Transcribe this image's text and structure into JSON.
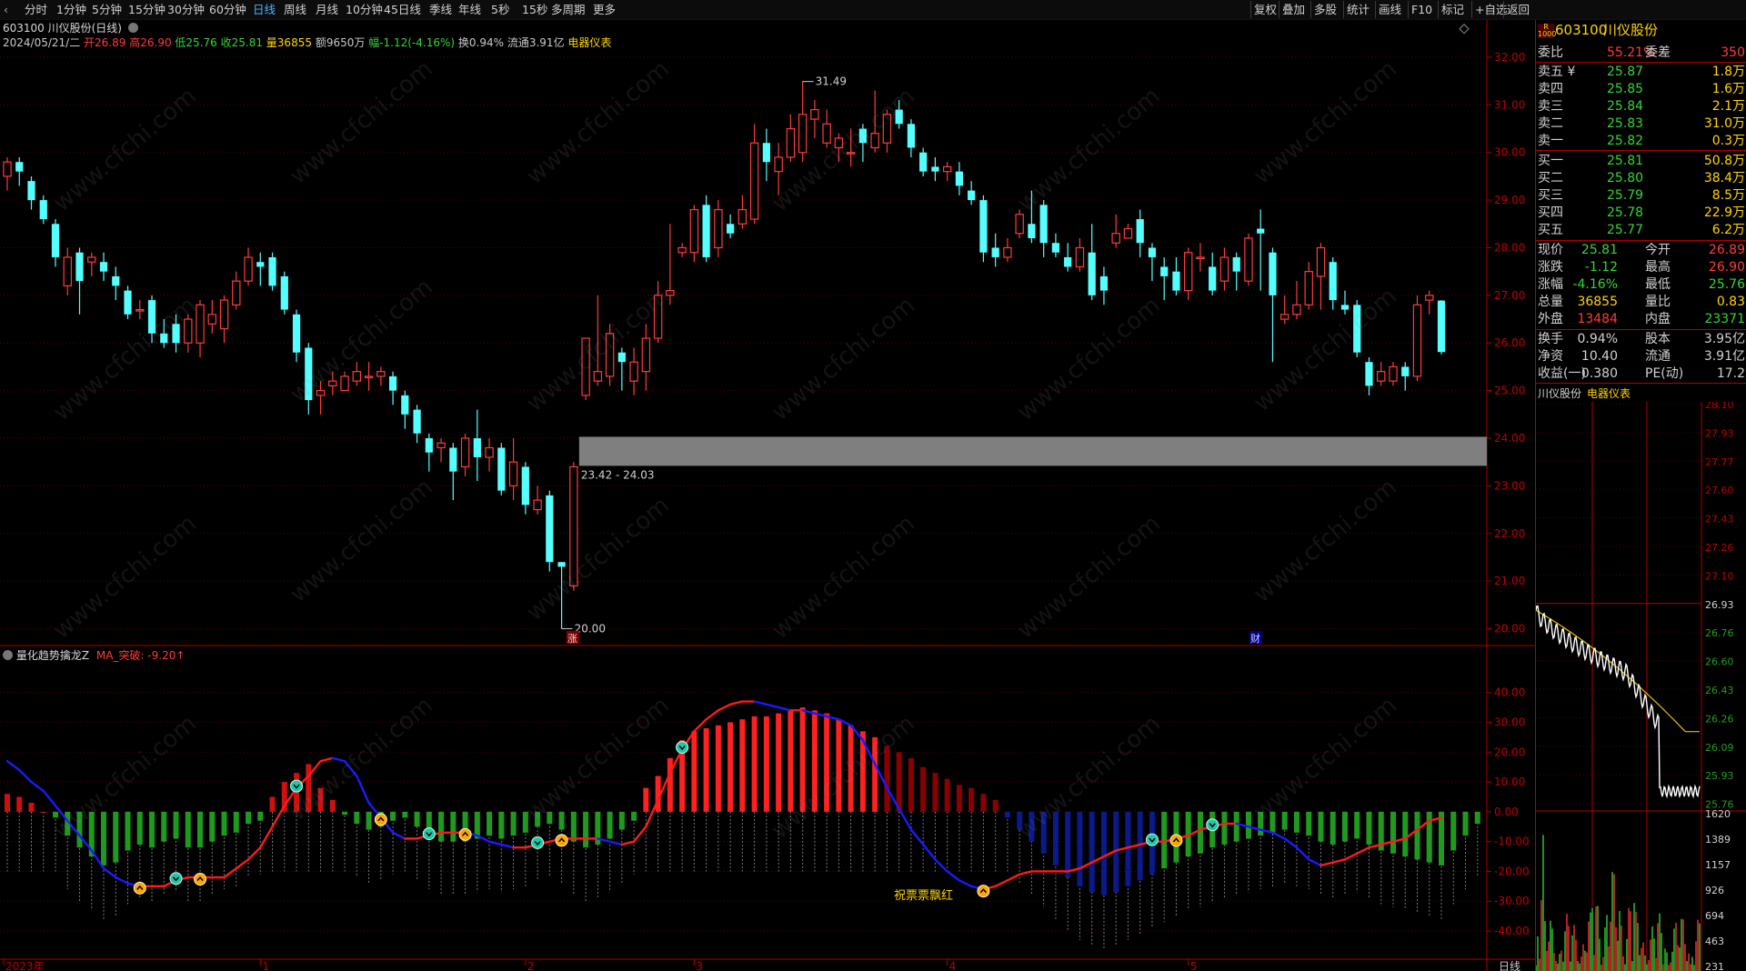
{
  "toolbar": {
    "periods": [
      "分时",
      "1分钟",
      "5分钟",
      "15分钟",
      "30分钟",
      "60分钟",
      "日线",
      "周线",
      "月线",
      "10分钟",
      "45日线",
      "季线",
      "年线",
      "5秒",
      "15秒",
      "多周期",
      "更多"
    ],
    "active_period": "日线",
    "tools": [
      "复权",
      "叠加",
      "多股",
      "统计",
      "画线",
      "F10",
      "标记",
      "+自选",
      "返回"
    ]
  },
  "main_chart": {
    "title": "603100 川仪股份(日线)",
    "info": {
      "date": "2024/05/21/二",
      "open": "开26.89",
      "high": "高26.90",
      "low": "低25.76",
      "close": "收25.81",
      "volume": "量36855",
      "amount": "额9650万",
      "change": "幅-1.12(-4.16%)",
      "turnover": "换0.94%",
      "float_cap": "流通3.91亿",
      "sector": "电器仪表"
    },
    "annotations": {
      "high_marker": "31.49",
      "low_marker": "20.00",
      "gap_range": "23.42 - 24.03",
      "event_up": "涨",
      "event_fin": "财"
    },
    "indicator_title": "量化趋势擒龙Z",
    "indicator_ma": "MA_突破: -9.20↑",
    "indicator_note": "祝票票飘红",
    "date_axis": [
      "2023年",
      "1",
      "2",
      "3",
      "4",
      "5"
    ],
    "period_label": "日线"
  },
  "chart_data": {
    "type": "candlestick",
    "price_ticks": [
      "32.00",
      "31.00",
      "30.00",
      "29.00",
      "28.00",
      "27.00",
      "26.00",
      "25.00",
      "24.00",
      "23.00",
      "22.00",
      "21.00",
      "20.00"
    ],
    "indicator_ticks": [
      "40.00",
      "30.00",
      "20.00",
      "10.00",
      "0.00",
      "-10.00",
      "-20.00",
      "-30.00",
      "-40.00"
    ],
    "ylim_price": [
      19.8,
      32.4
    ],
    "ylim_indicator": [
      -47,
      46
    ],
    "high_value": 31.49,
    "low_value": 20.0,
    "gap": [
      23.42,
      24.03
    ],
    "candles": [
      [
        29.5,
        29.8,
        29.2,
        29.9
      ],
      [
        29.8,
        29.6,
        29.3,
        29.9
      ],
      [
        29.4,
        29.0,
        28.8,
        29.5
      ],
      [
        29.0,
        28.6,
        28.5,
        29.1
      ],
      [
        28.5,
        27.8,
        27.6,
        28.6
      ],
      [
        27.2,
        27.8,
        27.0,
        28.0
      ],
      [
        27.9,
        27.3,
        26.6,
        28.0
      ],
      [
        27.7,
        27.8,
        27.4,
        27.9
      ],
      [
        27.7,
        27.5,
        27.3,
        27.9
      ],
      [
        27.4,
        27.2,
        26.9,
        27.6
      ],
      [
        27.1,
        26.6,
        26.5,
        27.2
      ],
      [
        26.7,
        26.7,
        26.5,
        26.9
      ],
      [
        26.9,
        26.2,
        26.0,
        27.0
      ],
      [
        26.2,
        26.0,
        25.9,
        26.5
      ],
      [
        26.4,
        26.0,
        25.8,
        26.6
      ],
      [
        26.0,
        26.5,
        25.8,
        26.6
      ],
      [
        26.0,
        26.8,
        25.7,
        26.9
      ],
      [
        26.4,
        26.6,
        26.2,
        26.9
      ],
      [
        26.3,
        26.9,
        26.0,
        27.0
      ],
      [
        26.8,
        27.3,
        26.7,
        27.5
      ],
      [
        27.3,
        27.8,
        27.2,
        28.0
      ],
      [
        27.7,
        27.6,
        27.2,
        27.9
      ],
      [
        27.8,
        27.2,
        27.1,
        27.9
      ],
      [
        27.4,
        26.7,
        26.6,
        27.5
      ],
      [
        26.6,
        25.8,
        25.6,
        26.7
      ],
      [
        25.9,
        24.8,
        24.5,
        26.0
      ],
      [
        24.9,
        25.0,
        24.5,
        25.2
      ],
      [
        25.1,
        25.2,
        24.9,
        25.4
      ],
      [
        25.0,
        25.3,
        25.0,
        25.4
      ],
      [
        25.2,
        25.4,
        25.1,
        25.6
      ],
      [
        25.3,
        25.3,
        25.0,
        25.6
      ],
      [
        25.3,
        25.4,
        25.1,
        25.5
      ],
      [
        25.3,
        25.0,
        24.7,
        25.4
      ],
      [
        24.9,
        24.5,
        24.2,
        25.0
      ],
      [
        24.6,
        24.1,
        23.9,
        24.7
      ],
      [
        24.0,
        23.7,
        23.3,
        24.1
      ],
      [
        23.8,
        23.9,
        23.5,
        24.0
      ],
      [
        23.8,
        23.3,
        22.7,
        23.9
      ],
      [
        23.4,
        24.0,
        23.2,
        24.1
      ],
      [
        24.0,
        23.6,
        23.1,
        24.6
      ],
      [
        23.6,
        23.8,
        23.3,
        24.0
      ],
      [
        23.8,
        22.9,
        22.8,
        23.9
      ],
      [
        23.0,
        23.5,
        22.7,
        24.0
      ],
      [
        23.4,
        22.6,
        22.4,
        23.5
      ],
      [
        22.5,
        22.7,
        22.4,
        23.0
      ],
      [
        22.8,
        21.4,
        21.2,
        22.9
      ],
      [
        21.4,
        21.3,
        20.0,
        21.4
      ],
      [
        20.9,
        23.4,
        20.8,
        23.5
      ],
      [
        24.9,
        26.1,
        24.8,
        26.1
      ],
      [
        25.2,
        25.4,
        25.1,
        27.0
      ],
      [
        25.3,
        26.2,
        25.1,
        26.4
      ],
      [
        25.8,
        25.6,
        25.0,
        25.9
      ],
      [
        25.2,
        25.6,
        24.9,
        25.9
      ],
      [
        25.4,
        26.1,
        25.0,
        26.4
      ],
      [
        26.1,
        27.0,
        26.0,
        27.3
      ],
      [
        27.0,
        27.1,
        26.8,
        28.5
      ],
      [
        27.9,
        28.0,
        27.8,
        28.1
      ],
      [
        27.9,
        28.8,
        27.7,
        28.9
      ],
      [
        28.9,
        27.8,
        27.7,
        29.1
      ],
      [
        28.0,
        28.8,
        27.8,
        29.0
      ],
      [
        28.5,
        28.3,
        28.2,
        28.7
      ],
      [
        28.5,
        28.8,
        28.4,
        29.1
      ],
      [
        28.6,
        30.2,
        28.5,
        30.6
      ],
      [
        30.2,
        29.8,
        29.4,
        30.5
      ],
      [
        29.6,
        29.9,
        29.1,
        30.2
      ],
      [
        29.9,
        30.5,
        29.8,
        30.8
      ],
      [
        30.0,
        30.8,
        29.8,
        31.5
      ],
      [
        30.7,
        30.9,
        30.3,
        31.1
      ],
      [
        30.2,
        30.6,
        30.1,
        30.9
      ],
      [
        30.1,
        30.3,
        29.8,
        30.4
      ],
      [
        30.0,
        30.0,
        29.7,
        30.5
      ],
      [
        30.5,
        30.2,
        29.8,
        30.6
      ],
      [
        30.1,
        30.4,
        30.0,
        31.3
      ],
      [
        30.2,
        30.8,
        30.0,
        30.9
      ],
      [
        30.9,
        30.6,
        30.5,
        31.1
      ],
      [
        30.6,
        30.1,
        29.9,
        30.7
      ],
      [
        30.0,
        29.6,
        29.5,
        30.1
      ],
      [
        29.7,
        29.6,
        29.4,
        29.9
      ],
      [
        29.6,
        29.7,
        29.4,
        29.8
      ],
      [
        29.6,
        29.3,
        29.1,
        29.8
      ],
      [
        29.2,
        29.0,
        28.9,
        29.4
      ],
      [
        29.0,
        27.9,
        27.7,
        29.1
      ],
      [
        28.0,
        27.8,
        27.6,
        28.3
      ],
      [
        27.8,
        28.0,
        27.7,
        28.2
      ],
      [
        28.3,
        28.7,
        28.2,
        28.8
      ],
      [
        28.5,
        28.2,
        28.1,
        29.2
      ],
      [
        28.9,
        28.1,
        27.8,
        29.0
      ],
      [
        28.1,
        27.9,
        27.8,
        28.3
      ],
      [
        27.8,
        27.6,
        27.5,
        28.1
      ],
      [
        27.6,
        28.0,
        27.5,
        28.2
      ],
      [
        27.9,
        27.0,
        26.9,
        28.5
      ],
      [
        27.4,
        27.1,
        26.8,
        27.6
      ],
      [
        28.1,
        28.3,
        28.0,
        28.7
      ],
      [
        28.2,
        28.4,
        28.2,
        28.5
      ],
      [
        28.6,
        28.1,
        27.8,
        28.8
      ],
      [
        28.0,
        27.8,
        27.3,
        28.1
      ],
      [
        27.6,
        27.4,
        26.9,
        27.8
      ],
      [
        27.5,
        27.1,
        27.0,
        27.8
      ],
      [
        27.1,
        27.9,
        26.9,
        28.0
      ],
      [
        27.8,
        27.8,
        27.5,
        28.1
      ],
      [
        27.6,
        27.1,
        27.0,
        27.9
      ],
      [
        27.3,
        27.8,
        27.1,
        28.0
      ],
      [
        27.8,
        27.5,
        27.1,
        27.9
      ],
      [
        27.3,
        28.2,
        27.2,
        28.3
      ],
      [
        28.4,
        28.3,
        27.1,
        28.8
      ],
      [
        27.9,
        27.0,
        25.6,
        28.0
      ],
      [
        26.5,
        26.6,
        26.4,
        27.0
      ],
      [
        26.6,
        26.8,
        26.5,
        27.3
      ],
      [
        26.8,
        27.5,
        26.7,
        27.7
      ],
      [
        27.4,
        28.0,
        26.7,
        28.1
      ],
      [
        27.7,
        26.9,
        26.7,
        27.8
      ],
      [
        26.8,
        26.7,
        26.6,
        27.1
      ],
      [
        26.8,
        25.8,
        25.7,
        26.9
      ],
      [
        25.6,
        25.1,
        24.9,
        25.7
      ],
      [
        25.2,
        25.4,
        25.1,
        25.6
      ],
      [
        25.2,
        25.5,
        25.1,
        25.6
      ],
      [
        25.5,
        25.3,
        25.0,
        25.6
      ],
      [
        25.3,
        26.8,
        25.2,
        27.0
      ],
      [
        26.9,
        27.0,
        26.6,
        27.1
      ],
      [
        26.89,
        25.81,
        25.76,
        26.9
      ]
    ],
    "macd_hist": [
      6,
      5,
      3,
      0,
      -2,
      -8,
      -12,
      -15,
      -18,
      -17,
      -13,
      -11,
      -12,
      -10,
      -9,
      -12,
      -12,
      -10,
      -8,
      -7,
      -4,
      -3,
      5,
      10,
      13,
      16,
      8,
      4,
      -1,
      -4,
      -6,
      -5,
      -3,
      -2,
      -5,
      -8,
      -10,
      -10,
      -10,
      -9,
      -8,
      -9,
      -8,
      -7,
      -5,
      -4,
      -6,
      -10,
      -12,
      -11,
      -9,
      -6,
      -3,
      8,
      12,
      18,
      24,
      27,
      28,
      29,
      30,
      31,
      32,
      32,
      33,
      34,
      35,
      34,
      33,
      31,
      29,
      27,
      25,
      22,
      20,
      18,
      15,
      13,
      11,
      9,
      8,
      6,
      4,
      -2,
      -6,
      -10,
      -14,
      -18,
      -22,
      -25,
      -27,
      -28,
      -27,
      -25,
      -23,
      -21,
      -19,
      -17,
      -15,
      -14,
      -12,
      -11,
      -10,
      -9,
      -8,
      -7,
      -6,
      -7,
      -8,
      -10,
      -11,
      -10,
      -9,
      -11,
      -13,
      -14,
      -15,
      -16,
      -17,
      -18,
      -13,
      -8,
      -4
    ],
    "trend_line": [
      17,
      14,
      10,
      7,
      2,
      -3,
      -8,
      -13,
      -19,
      -22,
      -24,
      -25,
      -25,
      -25,
      -23,
      -22,
      -22,
      -22,
      -22,
      -19,
      -16,
      -12,
      -5,
      2,
      8,
      12,
      17,
      18,
      17,
      12,
      3,
      -2,
      -7,
      -9,
      -9,
      -8,
      -7,
      -7,
      -7,
      -8,
      -10,
      -11,
      -12,
      -12,
      -11,
      -10,
      -9,
      -9,
      -9,
      -9,
      -10,
      -11,
      -10,
      -5,
      4,
      13,
      21,
      27,
      31,
      34,
      36,
      37,
      37,
      36,
      35,
      34,
      34,
      33,
      32,
      31,
      29,
      24,
      16,
      8,
      1,
      -6,
      -11,
      -16,
      -20,
      -23,
      -25,
      -26,
      -25,
      -23,
      -21,
      -20,
      -20,
      -20,
      -20,
      -19,
      -17,
      -15,
      -13,
      -12,
      -11,
      -10,
      -10,
      -9,
      -8,
      -6,
      -5,
      -4,
      -4,
      -5,
      -6,
      -7,
      -9,
      -12,
      -16,
      -18,
      -17,
      -16,
      -14,
      -12,
      -11,
      -10,
      -9,
      -6,
      -3,
      -2
    ],
    "buy_signals": [
      11,
      16,
      31,
      38,
      46,
      81,
      97
    ],
    "sell_signals": [
      14,
      24,
      35,
      44,
      56,
      95,
      100
    ],
    "tick_indices": [
      0,
      21,
      43,
      57,
      78,
      98
    ]
  },
  "quote": {
    "code": "603100",
    "name": "川仪股份",
    "weibi_label": "委比",
    "weibi": "55.21%",
    "weicha_label": "委差",
    "weicha": "350",
    "asks": [
      {
        "label": "卖五 ¥",
        "price": "25.87",
        "vol": "1.8万"
      },
      {
        "label": "卖四",
        "price": "25.85",
        "vol": "1.6万"
      },
      {
        "label": "卖三",
        "price": "25.84",
        "vol": "2.1万"
      },
      {
        "label": "卖二",
        "price": "25.83",
        "vol": "31.0万"
      },
      {
        "label": "卖一",
        "price": "25.82",
        "vol": "0.3万"
      }
    ],
    "bids": [
      {
        "label": "买一",
        "price": "25.81",
        "vol": "50.8万"
      },
      {
        "label": "买二",
        "price": "25.80",
        "vol": "38.4万"
      },
      {
        "label": "买三",
        "price": "25.79",
        "vol": "8.5万"
      },
      {
        "label": "买四",
        "price": "25.78",
        "vol": "22.9万"
      },
      {
        "label": "买五",
        "price": "25.77",
        "vol": "6.2万"
      }
    ],
    "stats": [
      {
        "l1": "现价",
        "v1": "25.81",
        "c1": "#36d436",
        "l2": "今开",
        "v2": "26.89",
        "c2": "#ff3b3b"
      },
      {
        "l1": "涨跌",
        "v1": "-1.12",
        "c1": "#36d436",
        "l2": "最高",
        "v2": "26.90",
        "c2": "#ff3b3b"
      },
      {
        "l1": "涨幅",
        "v1": "-4.16%",
        "c1": "#36d436",
        "l2": "最低",
        "v2": "25.76",
        "c2": "#36d436"
      },
      {
        "l1": "总量",
        "v1": "36855",
        "c1": "#ffd500",
        "l2": "量比",
        "v2": "0.83",
        "c2": "#ffd500"
      },
      {
        "l1": "外盘",
        "v1": "13484",
        "c1": "#ff3b3b",
        "l2": "内盘",
        "v2": "23371",
        "c2": "#36d436"
      }
    ],
    "stats2": [
      {
        "l1": "换手",
        "v1": "0.94%",
        "l2": "股本",
        "v2": "3.95亿"
      },
      {
        "l1": "净资",
        "v1": "10.40",
        "l2": "流通",
        "v2": "3.91亿"
      },
      {
        "l1": "收益(一)",
        "v1": "0.380",
        "l2": "PE(动)",
        "v2": "17.2"
      }
    ],
    "mini_title": "川仪股份",
    "mini_sector": "电器仪表",
    "mini_price_ticks": [
      "28.10",
      "27.93",
      "27.77",
      "27.60",
      "27.43",
      "27.26",
      "27.10",
      "26.93",
      "26.76",
      "26.60",
      "26.43",
      "26.26",
      "26.09",
      "25.93",
      "25.76"
    ],
    "mini_vol_ticks": [
      "1620",
      "1389",
      "1157",
      "926",
      "694",
      "463",
      "231"
    ]
  },
  "colors": {
    "up": "#ff3b3b",
    "down": "#54ffff",
    "green": "#1f9a1f",
    "blue": "#1a1aff",
    "gap": "#7f7f7f",
    "axis": "#b00000"
  }
}
